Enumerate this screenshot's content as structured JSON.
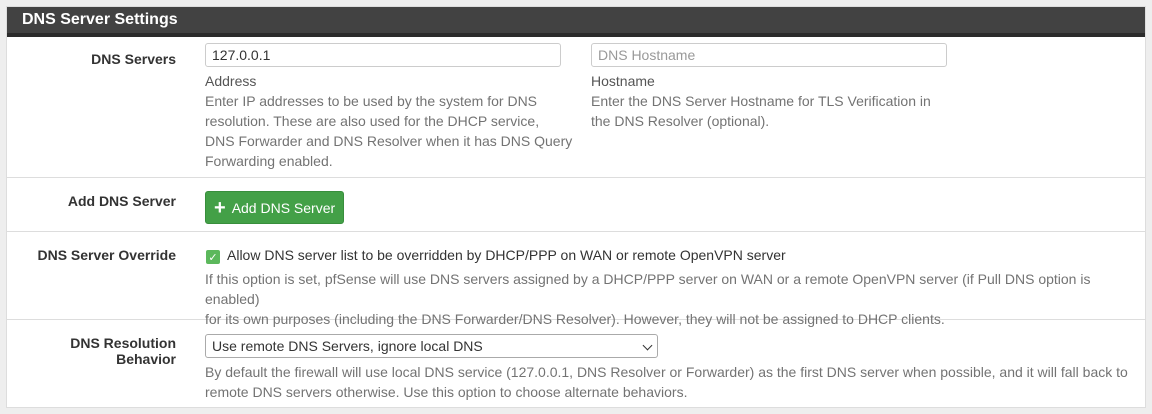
{
  "panel": {
    "title": "DNS Server Settings"
  },
  "dns_servers": {
    "label": "DNS Servers",
    "address_value": "127.0.0.1",
    "address_sublabel": "Address",
    "address_help": [
      "Enter IP addresses to be used by the system for DNS",
      "resolution. These are also used for the DHCP service,",
      "DNS Forwarder and DNS Resolver when it has DNS Query",
      "Forwarding enabled."
    ],
    "hostname_placeholder": "DNS Hostname",
    "hostname_sublabel": "Hostname",
    "hostname_help": [
      "Enter the DNS Server Hostname for TLS Verification in",
      "the DNS Resolver (optional)."
    ]
  },
  "add_dns_server": {
    "label": "Add DNS Server",
    "button_label": "Add DNS Server",
    "button_icon": "plus-icon"
  },
  "dns_override": {
    "label": "DNS Server Override",
    "checked": true,
    "checkbox_label": "Allow DNS server list to be overridden by DHCP/PPP on WAN or remote OpenVPN server",
    "help": [
      "If this option is set, pfSense will use DNS servers assigned by a DHCP/PPP server on WAN or a remote OpenVPN server (if Pull DNS option is enabled)",
      "for its own purposes (including the DNS Forwarder/DNS Resolver). However, they will not be assigned to DHCP clients."
    ]
  },
  "dns_resolution": {
    "label": "DNS Resolution Behavior",
    "selected": "Use remote DNS Servers, ignore local DNS",
    "help": [
      "By default the firewall will use local DNS service (127.0.0.1, DNS Resolver or Forwarder) as the first DNS server when possible, and it will fall back to",
      "remote DNS servers otherwise. Use this option to choose alternate behaviors."
    ]
  },
  "colors": {
    "heading_bg": "#424242",
    "button_green": "#43a047",
    "check_green": "#5cb85c"
  }
}
